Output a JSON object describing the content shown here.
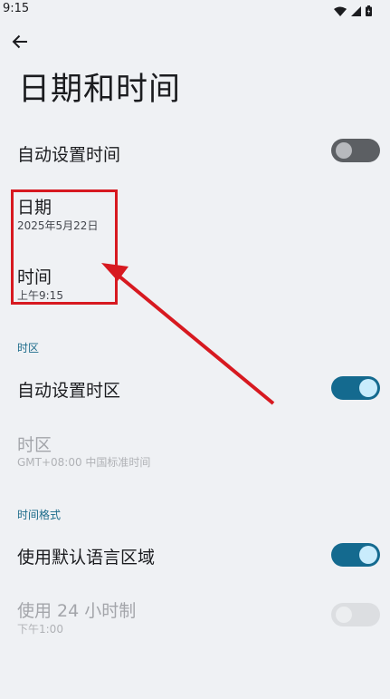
{
  "status_bar": {
    "time": "9:15",
    "icons": [
      "wifi-icon",
      "cellular-signal-icon",
      "battery-icon"
    ]
  },
  "header": {
    "back_icon": "arrow-left-icon",
    "title": "日期和时间"
  },
  "settings": {
    "auto_time": {
      "label": "自动设置时间",
      "toggle_state": "off"
    },
    "date": {
      "label": "日期",
      "value": "2025年5月22日"
    },
    "time": {
      "label": "时间",
      "value": "上午9:15"
    },
    "timezone_section": {
      "header": "时区"
    },
    "auto_timezone": {
      "label": "自动设置时区",
      "toggle_state": "on"
    },
    "timezone": {
      "label": "时区",
      "value": "GMT+08:00 中国标准时间",
      "enabled": false
    },
    "format_section": {
      "header": "时间格式"
    },
    "use_locale_default": {
      "label": "使用默认语言区域",
      "toggle_state": "on"
    },
    "use_24_hour": {
      "label": "使用 24 小时制",
      "value": "下午1:00",
      "toggle_state": "off",
      "enabled": false
    }
  },
  "colors": {
    "background": "#eff1f4",
    "accent": "#146a8f",
    "annotation": "#d71920"
  }
}
